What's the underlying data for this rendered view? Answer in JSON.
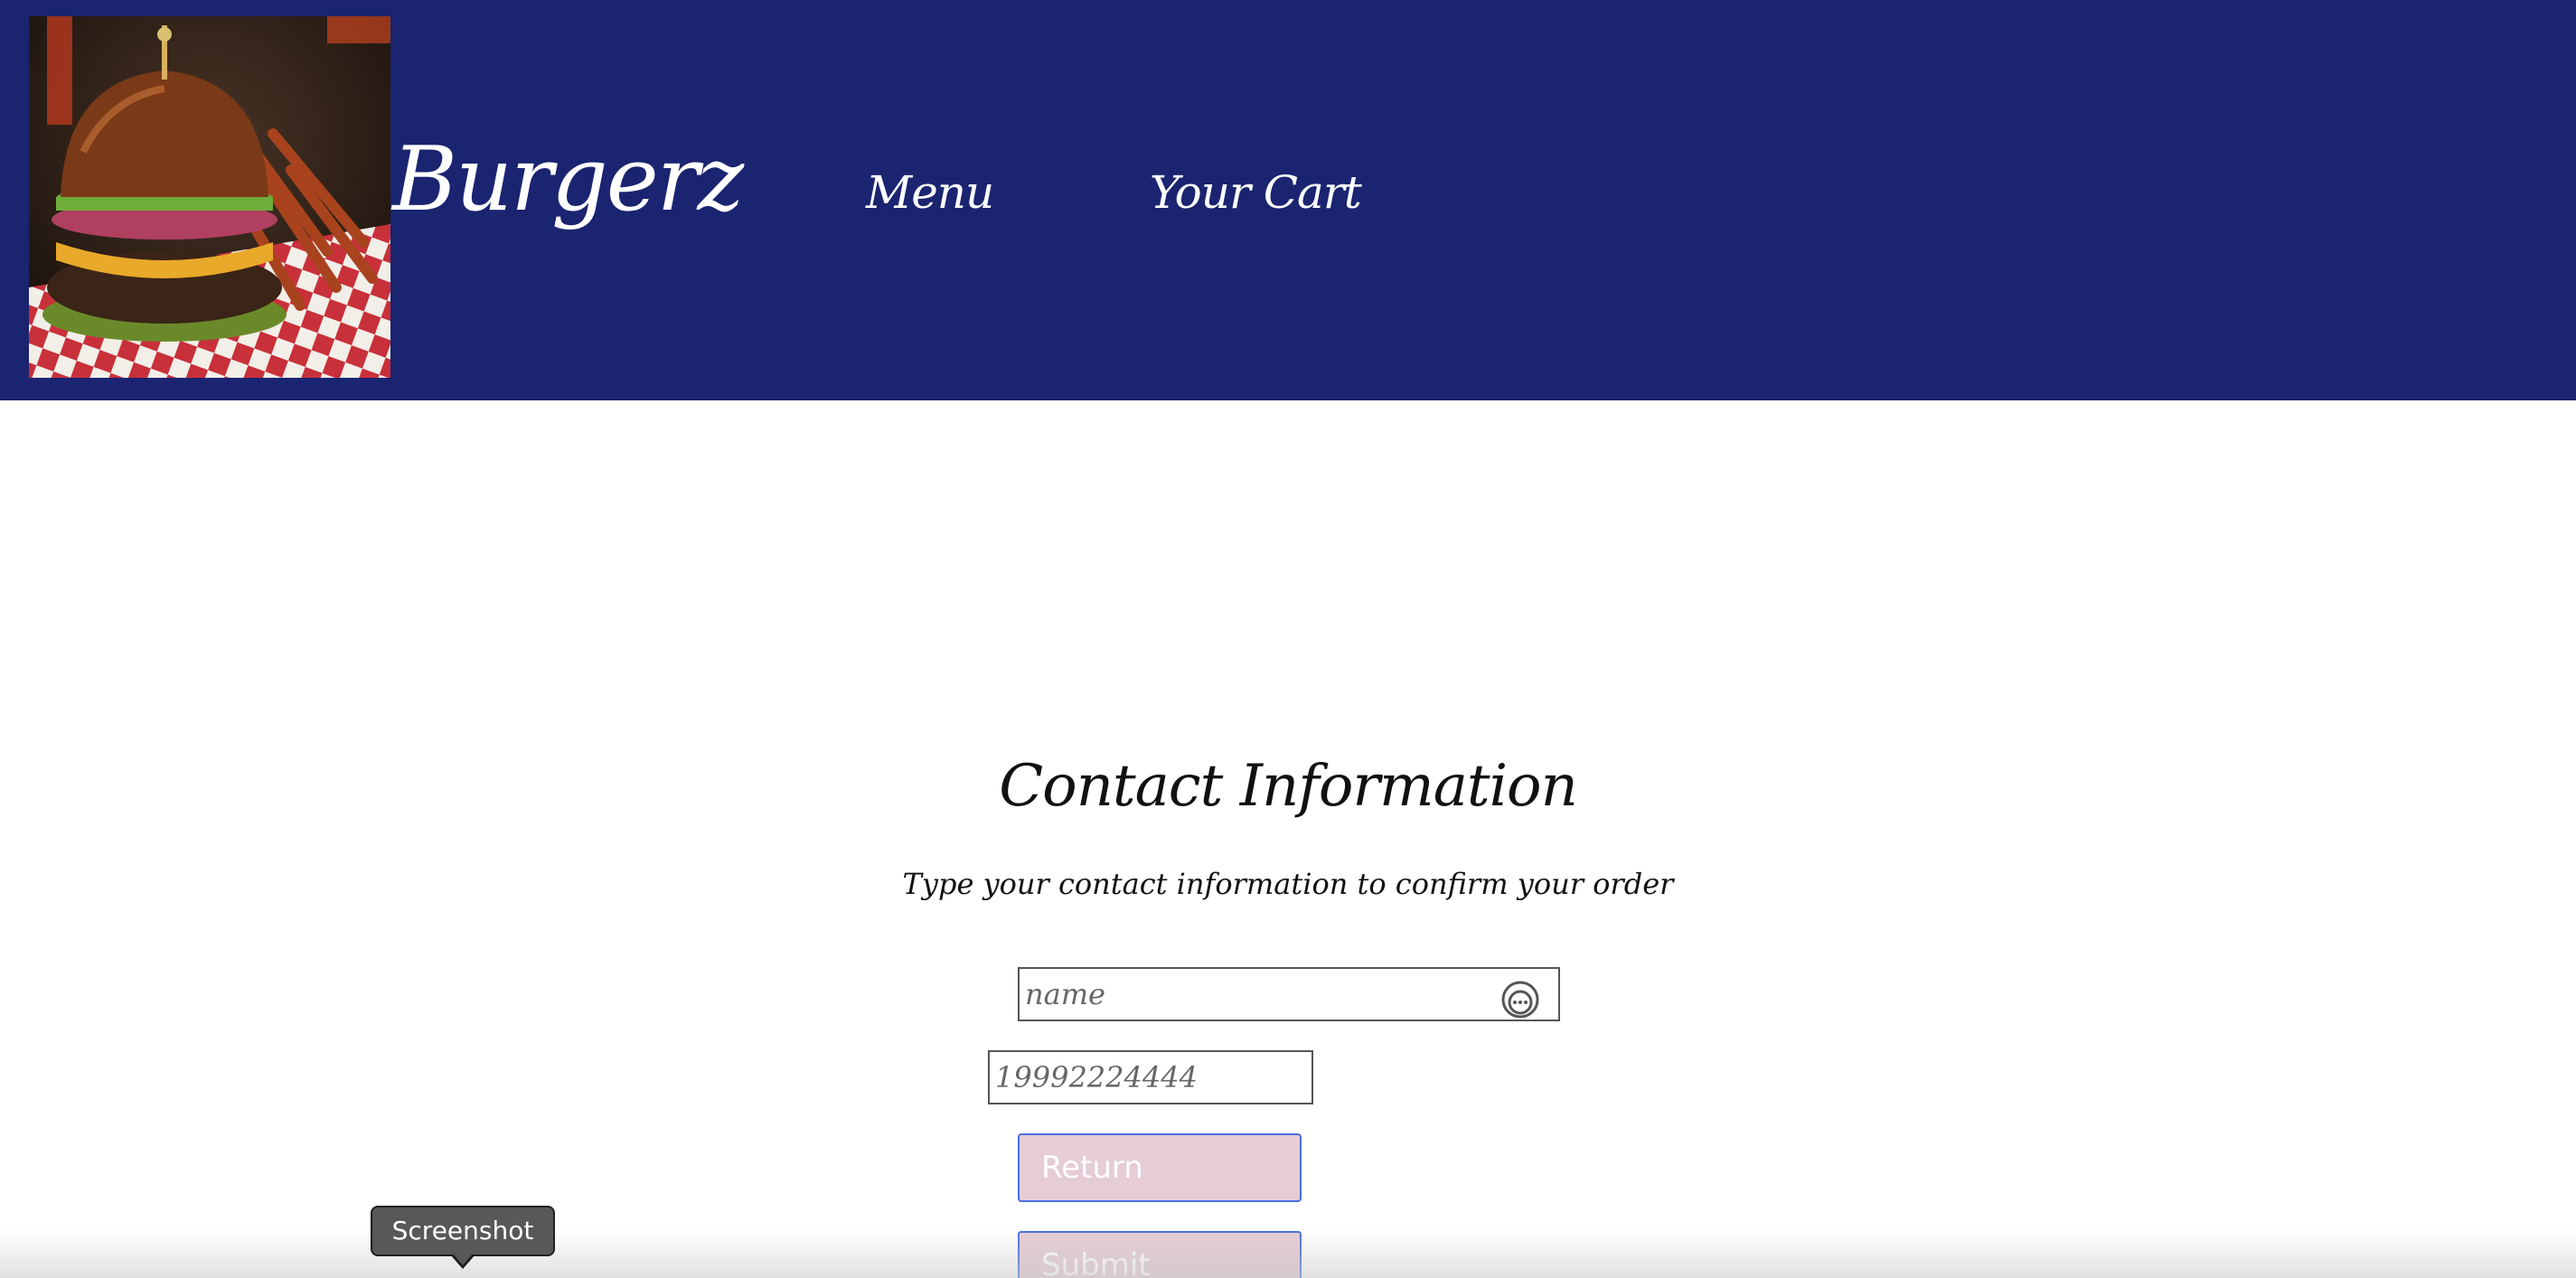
{
  "header": {
    "brand": "Burgerz",
    "nav": [
      {
        "label": "Menu"
      },
      {
        "label": "Your Cart"
      }
    ],
    "logo_icon": "burger-photo",
    "background_color": "#1a2470"
  },
  "contact": {
    "title": "Contact Information",
    "subtitle": "Type your contact information to confirm your order",
    "name_placeholder": "name",
    "phone_placeholder": "19992224444",
    "name_field_icon": "autofill-icon",
    "return_label": "Return",
    "submit_label": "Submit",
    "button_color": "#e6ccd6",
    "button_border_color": "#4a6ee0"
  },
  "tooltip": {
    "label": "Screenshot"
  }
}
